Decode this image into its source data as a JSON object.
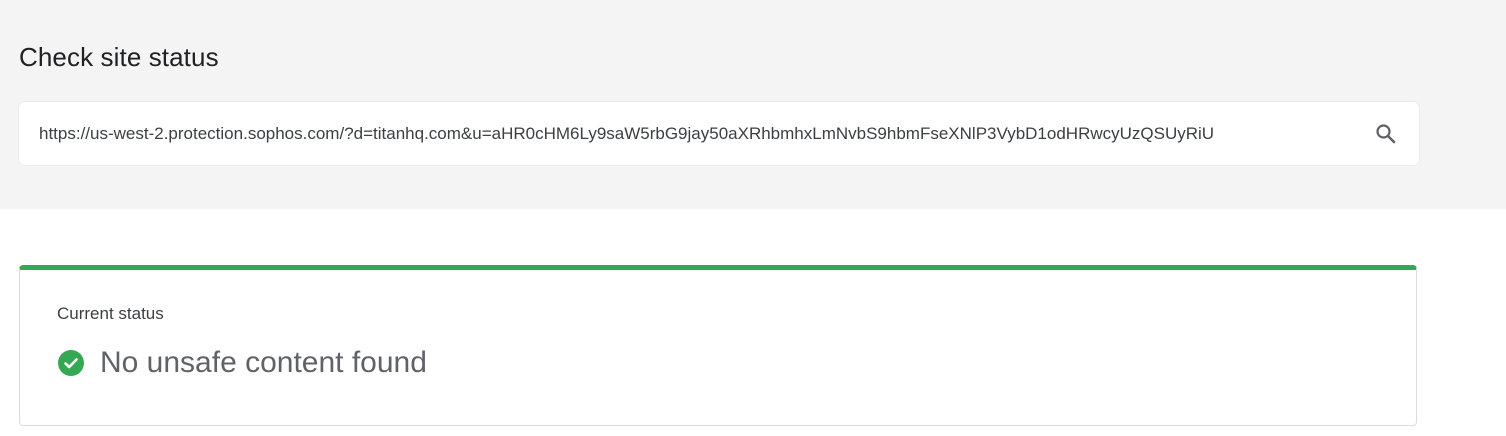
{
  "header": {
    "title": "Check site status"
  },
  "search": {
    "value": "https://us-west-2.protection.sophos.com/?d=titanhq.com&u=aHR0cHM6Ly9saW5rbG9jay50aXRhbmhxLmNvbS9hbmFseXNlP3VybD1odHRwcyUzQSUyRiU",
    "icon": "search-icon"
  },
  "status": {
    "label": "Current status",
    "result": "No unsafe content found",
    "icon": "check-circle-icon",
    "accent_color": "#34a853"
  }
}
